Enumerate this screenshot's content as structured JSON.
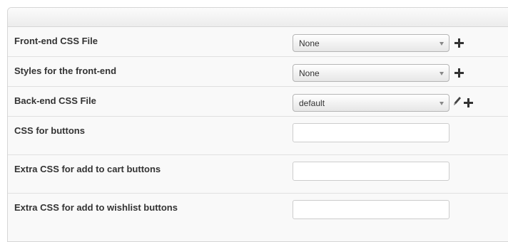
{
  "rows": [
    {
      "label": "Front-end CSS File",
      "type": "select",
      "value": "None",
      "actions": [
        "plus-icon"
      ]
    },
    {
      "label": "Styles for the front-end",
      "type": "select",
      "value": "None",
      "actions": [
        "plus-icon"
      ]
    },
    {
      "label": "Back-end CSS File",
      "type": "select",
      "value": "default",
      "actions": [
        "pencil-icon",
        "plus-icon"
      ]
    },
    {
      "label": "CSS for buttons",
      "type": "text",
      "value": ""
    },
    {
      "label": "Extra CSS for add to cart buttons",
      "type": "text",
      "value": ""
    },
    {
      "label": "Extra CSS for add to wishlist buttons",
      "type": "text",
      "value": ""
    }
  ]
}
